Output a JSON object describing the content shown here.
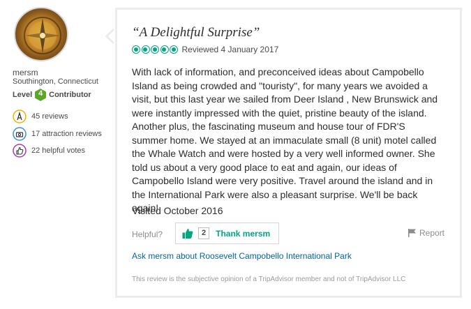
{
  "member": {
    "username": "mersm",
    "hometown": "Southington, Connecticut",
    "level_prefix": "Level",
    "level_number": "4",
    "level_suffix": "Contributor",
    "stats": [
      {
        "icon": "quill-pen-icon",
        "text": "45 reviews"
      },
      {
        "icon": "attraction-icon",
        "text": "17 attraction reviews"
      },
      {
        "icon": "thumbs-up-icon",
        "text": "22 helpful votes"
      }
    ]
  },
  "review": {
    "title": "“A Delightful Surprise”",
    "rating": 5,
    "rating_max": 5,
    "reviewed": "Reviewed 4 January 2017",
    "body": "With lack of information, and preconceived ideas about Campobello Island as being crowded and \"touristy\", for many years we avoided a visit, but this last year we sailed from Deer Island , New Brunswick and were instantly impressed with the quiet, pristine beauty of the island. Another plus, the fascinating museum and house tour of FDR'S summer home. We stayed at an immaculate small (8 unit) motel called the Whale Watch and were hosted by a very well informed owner. She told us about a very good place to eat and again, our ideas of Campobello Island were very positive. Travel around the island and in the International Park were also a pleasant surprise. We'll be back again!",
    "visited": "Visited October 2016",
    "helpful_label": "Helpful?",
    "thank_count": "2",
    "thank_label": "Thank mersm",
    "report_label": "Report",
    "ask_link": "Ask mersm about Roosevelt Campobello International Park",
    "disclaimer": "This review is the subjective opinion of a TripAdvisor member and not of TripAdvisor LLC"
  },
  "colors": {
    "accent": "#00a680",
    "link": "#006699",
    "level_badge": "#5ba626"
  }
}
